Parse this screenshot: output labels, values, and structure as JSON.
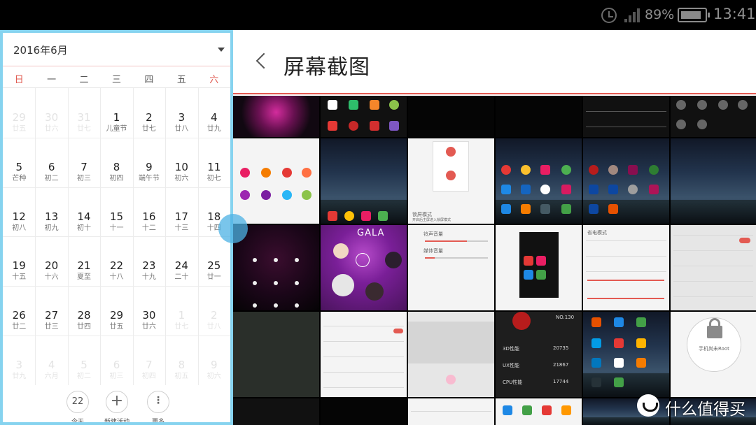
{
  "status_bar": {
    "battery_percent": "89%",
    "battery_level": 0.89,
    "time": "13:41"
  },
  "calendar": {
    "month_label": "2016年6月",
    "weekdays": [
      "日",
      "一",
      "二",
      "三",
      "四",
      "五",
      "六"
    ],
    "weeks": [
      [
        {
          "d": "29",
          "l": "廿五",
          "dim": true
        },
        {
          "d": "30",
          "l": "廿六",
          "dim": true
        },
        {
          "d": "31",
          "l": "廿七",
          "dim": true
        },
        {
          "d": "1",
          "l": "儿童节"
        },
        {
          "d": "2",
          "l": "廿七"
        },
        {
          "d": "3",
          "l": "廿八"
        },
        {
          "d": "4",
          "l": "廿九"
        }
      ],
      [
        {
          "d": "5",
          "l": "芒种"
        },
        {
          "d": "6",
          "l": "初二"
        },
        {
          "d": "7",
          "l": "初三"
        },
        {
          "d": "8",
          "l": "初四"
        },
        {
          "d": "9",
          "l": "端午节"
        },
        {
          "d": "10",
          "l": "初六"
        },
        {
          "d": "11",
          "l": "初七"
        }
      ],
      [
        {
          "d": "12",
          "l": "初八"
        },
        {
          "d": "13",
          "l": "初九"
        },
        {
          "d": "14",
          "l": "初十"
        },
        {
          "d": "15",
          "l": "十一"
        },
        {
          "d": "16",
          "l": "十二"
        },
        {
          "d": "17",
          "l": "十三"
        },
        {
          "d": "18",
          "l": "十四"
        }
      ],
      [
        {
          "d": "19",
          "l": "十五"
        },
        {
          "d": "20",
          "l": "十六"
        },
        {
          "d": "21",
          "l": "夏至"
        },
        {
          "d": "22",
          "l": "十八"
        },
        {
          "d": "23",
          "l": "十九"
        },
        {
          "d": "24",
          "l": "二十"
        },
        {
          "d": "25",
          "l": "廿一"
        }
      ],
      [
        {
          "d": "26",
          "l": "廿二"
        },
        {
          "d": "27",
          "l": "廿三"
        },
        {
          "d": "28",
          "l": "廿四"
        },
        {
          "d": "29",
          "l": "廿五"
        },
        {
          "d": "30",
          "l": "廿六"
        },
        {
          "d": "1",
          "l": "廿七",
          "dim": true
        },
        {
          "d": "2",
          "l": "廿八",
          "dim": true
        }
      ],
      [
        {
          "d": "3",
          "l": "廿九",
          "dim": true
        },
        {
          "d": "4",
          "l": "六月",
          "dim": true
        },
        {
          "d": "5",
          "l": "初二",
          "dim": true
        },
        {
          "d": "6",
          "l": "初三",
          "dim": true
        },
        {
          "d": "7",
          "l": "初四",
          "dim": true
        },
        {
          "d": "8",
          "l": "初五",
          "dim": true
        },
        {
          "d": "9",
          "l": "初六",
          "dim": true
        }
      ]
    ],
    "footer": {
      "today_number": "22",
      "today_label": "今天",
      "new_event_label": "新建活动",
      "more_label": "更多"
    }
  },
  "gallery": {
    "title": "屏幕截图",
    "thumb_texts": {
      "lock_setting": "锁屏模式",
      "lock_desc": "开启后主屏进入锁屏模式",
      "volume_ring": "铃声音量",
      "volume_media": "媒体音量",
      "gala": "GALA",
      "battery_mode": "省电模式",
      "screen_root": "手机尚未Root",
      "score_1": "20735",
      "score_2": "21867",
      "score_3": "17744",
      "antutu": "NO.130",
      "cpu_label": "CPU性能",
      "ux_label": "UX性能",
      "ram_label": "3D性能"
    }
  },
  "watermark": {
    "text": "什么值得买"
  }
}
